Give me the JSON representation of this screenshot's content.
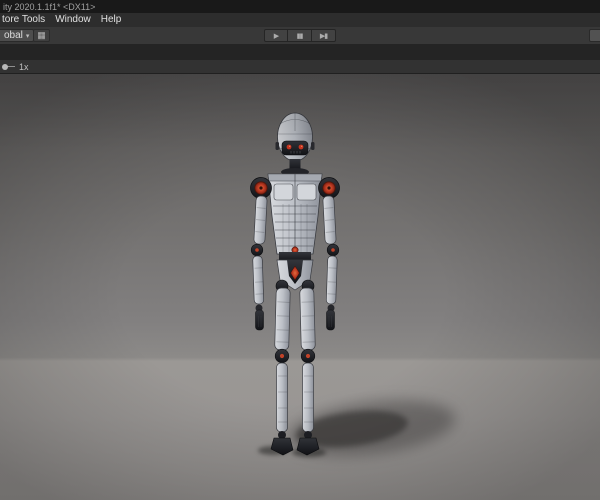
{
  "window": {
    "title": "ity 2020.1.1f1* <DX11>"
  },
  "menubar": {
    "items": [
      {
        "label": "tore Tools"
      },
      {
        "label": "Window"
      },
      {
        "label": "Help"
      }
    ]
  },
  "toolbar": {
    "global_button": {
      "label": "obal",
      "caret_glyph": "▾"
    },
    "grid_button_glyph": "▦",
    "playbar": {
      "play_glyph": "▶",
      "pause_glyph": "▮▮",
      "step_glyph": "▶▮"
    }
  },
  "gameview_bar": {
    "scale_label": "1x"
  },
  "colors": {
    "toolbar_bg": "#383838",
    "accent_red": "#b23522",
    "panel_silver": "#c7cad1",
    "joint_dark": "#1a1b20",
    "backdrop_top": "#5f5d5d",
    "floor": "#999694"
  }
}
